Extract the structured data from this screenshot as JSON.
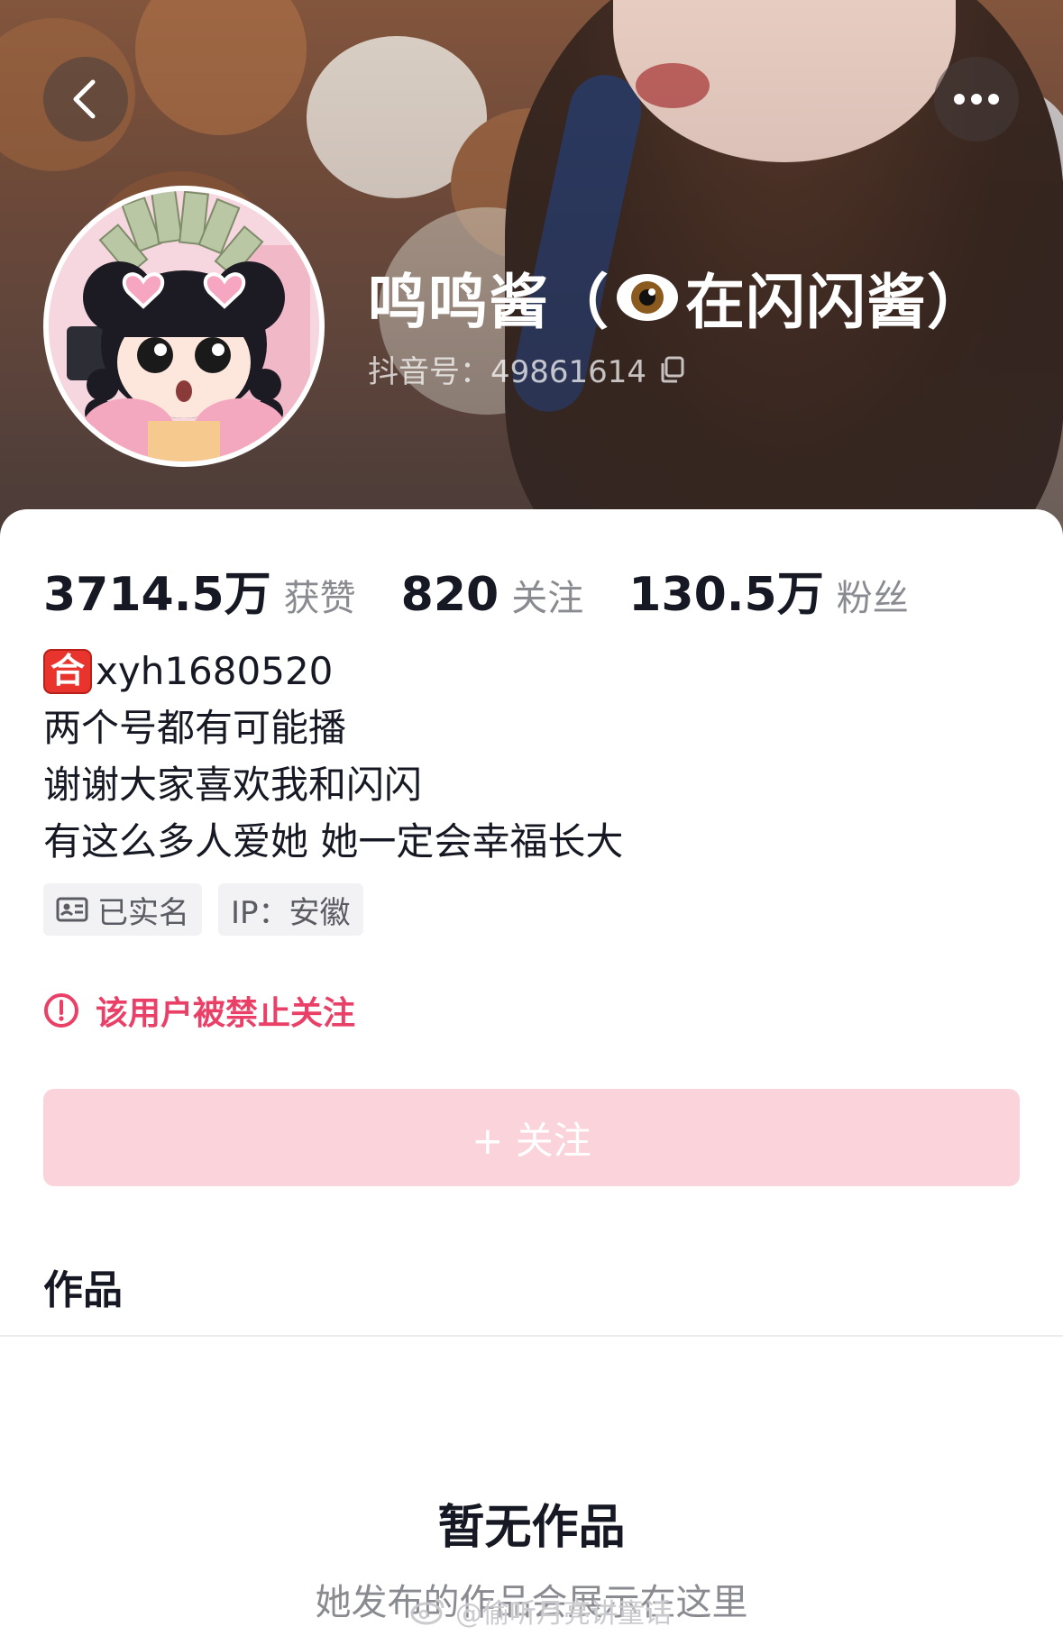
{
  "header": {
    "nickname_prefix": "鸣鸣酱（",
    "nickname_suffix": "在闪闪酱）",
    "douyin_id": "抖音号：49861614"
  },
  "stats": [
    {
      "value": "3714.5万",
      "label": "获赞"
    },
    {
      "value": "820",
      "label": "关注"
    },
    {
      "value": "130.5万",
      "label": "粉丝"
    }
  ],
  "bio": {
    "badge_char": "合",
    "line1_text": "xyh1680520",
    "line2": "两个号都有可能播",
    "line3": "谢谢大家喜欢我和闪闪",
    "line4": "有这么多人爱她 她一定会幸福长大"
  },
  "tags": {
    "verified": "已实名",
    "ip": "IP：安徽"
  },
  "notice": {
    "banned_text": "该用户被禁止关注"
  },
  "follow_button": {
    "label": "+ 关注"
  },
  "tabs": {
    "works": "作品"
  },
  "empty_state": {
    "title": "暂无作品",
    "subtitle": "她发布的作品会展示在这里"
  },
  "watermark": {
    "text": "@偷听月亮讲童话"
  },
  "colors": {
    "accent": "#ea3f67",
    "follow_button_bg": "#fbd3da",
    "muted_text": "#8a8b91"
  }
}
